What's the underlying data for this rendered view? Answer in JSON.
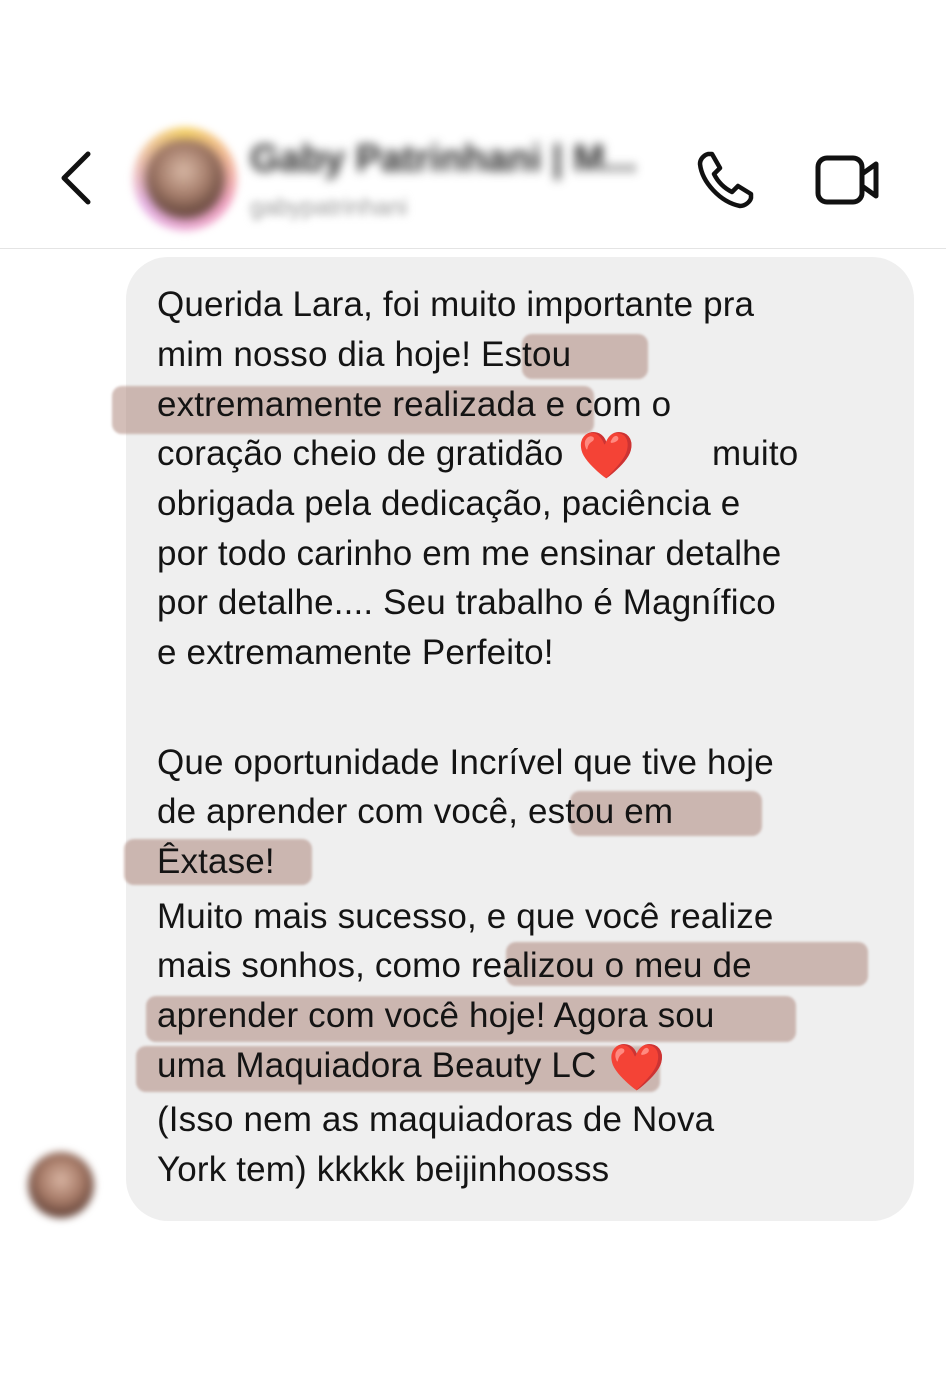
{
  "header": {
    "contact_name": "Gaby Patrinhani | M...",
    "contact_handle": "gabypatrinhani"
  },
  "message": {
    "lines": [
      "Querida Lara, foi muito importante pra",
      "mim  nosso dia hoje! Estou",
      "extremamente realizada e com o",
      "coração cheio de gratidão",
      "muito",
      "obrigada pela dedicação, paciência e",
      "por todo carinho em me ensinar detalhe",
      "por detalhe.... Seu trabalho é Magnífico",
      "e extremamente Perfeito!",
      "Que oportunidade Incrível que tive hoje",
      "de aprender com você, estou em",
      "Êxtase!",
      "Muito mais sucesso, e que você realize",
      "mais sonhos, como realizou o meu de",
      "aprender com você hoje! Agora sou",
      "uma Maquiadora Beauty LC",
      "(Isso nem as maquiadoras de Nova",
      "York tem) kkkkk beijinhoosss"
    ],
    "emoji": "❤️"
  },
  "icons": {
    "back": "chevron-left-icon",
    "phone": "phone-icon",
    "video": "video-camera-icon",
    "heart": "red-heart-emoji"
  },
  "colors": {
    "bubble": "#efefef",
    "highlight": "#b08c80",
    "heart": "#e0121e"
  }
}
